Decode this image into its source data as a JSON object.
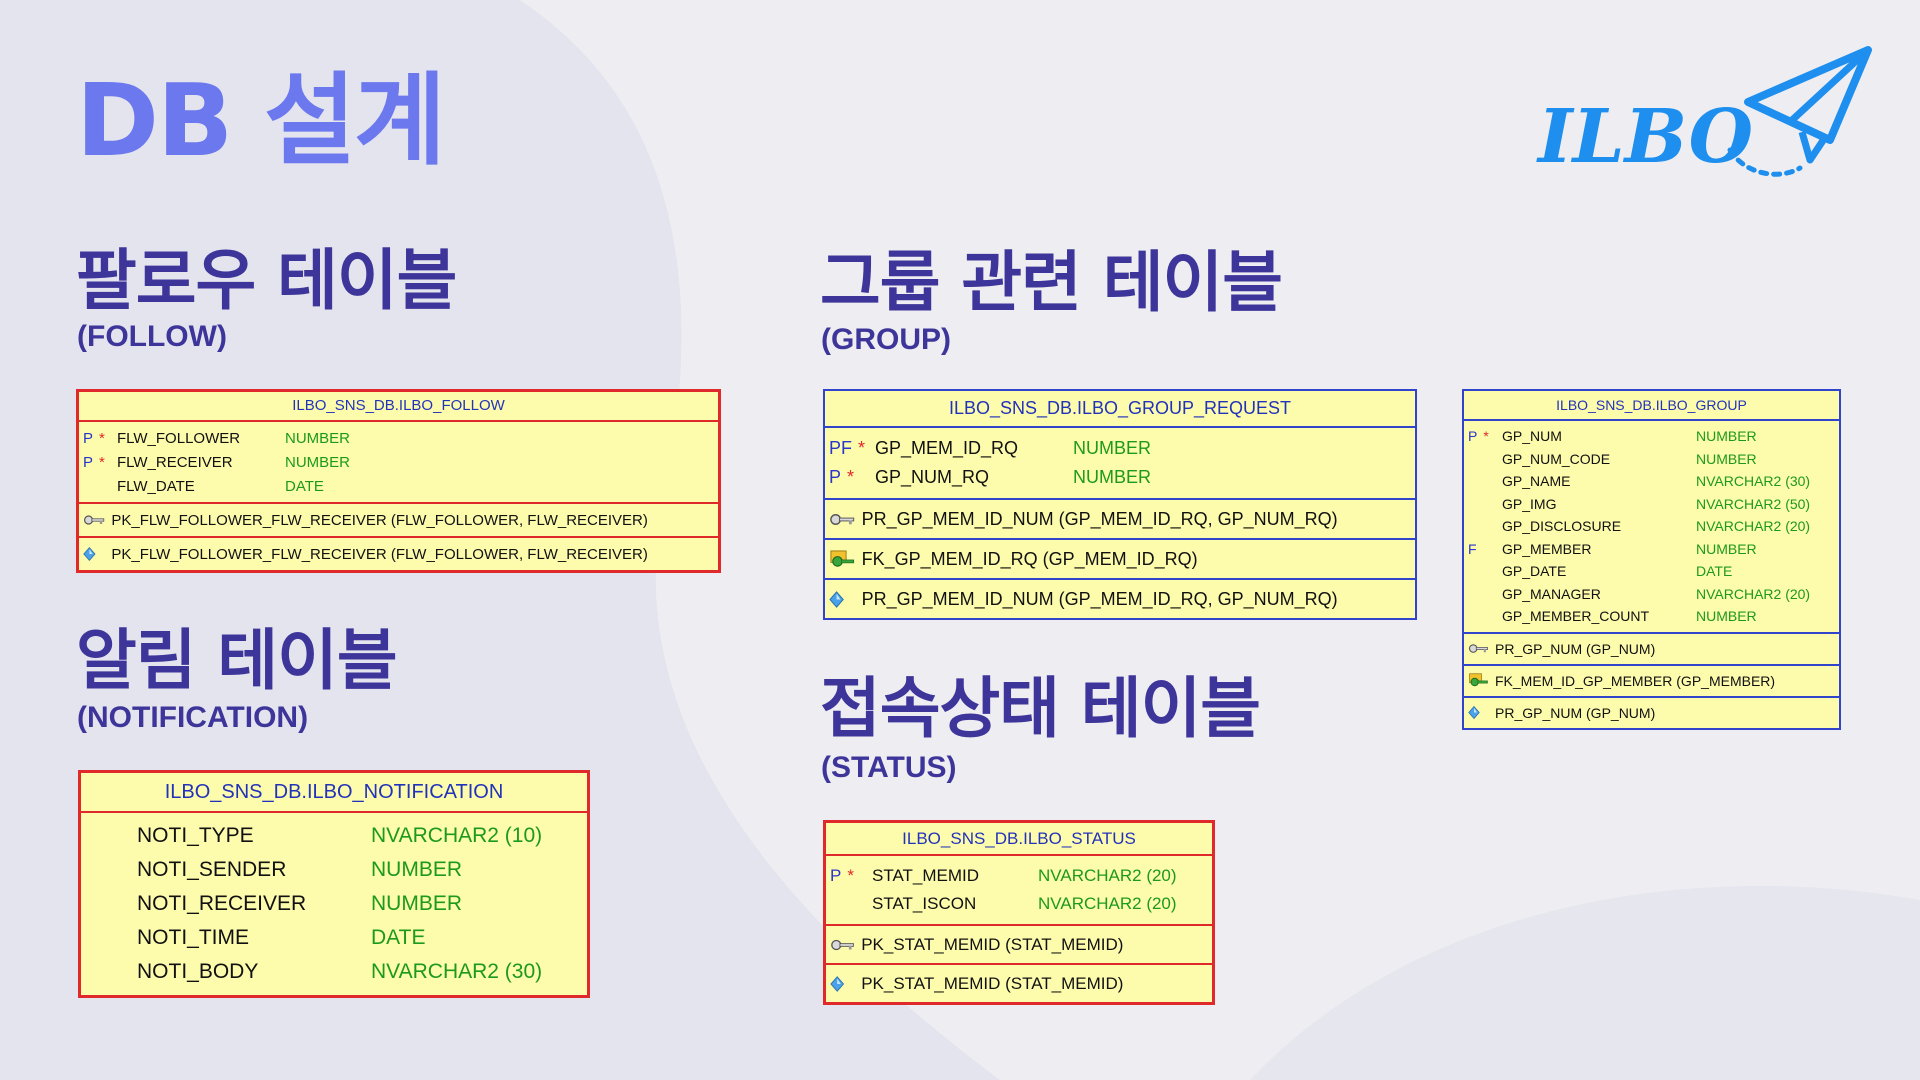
{
  "page": {
    "title": "DB 설계",
    "logo_text": "ILBO",
    "colors": {
      "title": "#6b78ee",
      "heading": "#3d359a",
      "logo": "#1e8fee",
      "erd_bg": "#fdfbac",
      "erd_red": "#e0292a",
      "erd_blue": "#3344cc",
      "type_green": "#1d9a1d"
    }
  },
  "sections": {
    "follow": {
      "title": "팔로우 테이블",
      "subtitle": "(FOLLOW)"
    },
    "notification": {
      "title": "알림 테이블",
      "subtitle": "(NOTIFICATION)"
    },
    "group": {
      "title": "그룹 관련 테이블",
      "subtitle": "(GROUP)"
    },
    "status": {
      "title": "접속상태 테이블",
      "subtitle": "(STATUS)"
    }
  },
  "tables": {
    "follow": {
      "name": "ILBO_SNS_DB.ILBO_FOLLOW",
      "columns": [
        {
          "flag": "P",
          "required": "*",
          "name": "FLW_FOLLOWER",
          "type": "NUMBER"
        },
        {
          "flag": "P",
          "required": "*",
          "name": "FLW_RECEIVER",
          "type": "NUMBER"
        },
        {
          "flag": "",
          "required": "",
          "name": "FLW_DATE",
          "type": "DATE"
        }
      ],
      "keys": [
        {
          "icon": "primary-key-icon",
          "text": "PK_FLW_FOLLOWER_FLW_RECEIVER (FLW_FOLLOWER, FLW_RECEIVER)"
        },
        {
          "icon": "index-diamond-icon",
          "text": "PK_FLW_FOLLOWER_FLW_RECEIVER (FLW_FOLLOWER, FLW_RECEIVER)"
        }
      ]
    },
    "notification": {
      "name": "ILBO_SNS_DB.ILBO_NOTIFICATION",
      "columns": [
        {
          "flag": "",
          "required": "",
          "name": "NOTI_TYPE",
          "type": "NVARCHAR2 (10)"
        },
        {
          "flag": "",
          "required": "",
          "name": "NOTI_SENDER",
          "type": "NUMBER"
        },
        {
          "flag": "",
          "required": "",
          "name": "NOTI_RECEIVER",
          "type": "NUMBER"
        },
        {
          "flag": "",
          "required": "",
          "name": "NOTI_TIME",
          "type": "DATE"
        },
        {
          "flag": "",
          "required": "",
          "name": "NOTI_BODY",
          "type": "NVARCHAR2 (30)"
        }
      ],
      "keys": []
    },
    "group_request": {
      "name": "ILBO_SNS_DB.ILBO_GROUP_REQUEST",
      "columns": [
        {
          "flag": "PF",
          "required": "*",
          "name": "GP_MEM_ID_RQ",
          "type": "NUMBER"
        },
        {
          "flag": "P",
          "required": "*",
          "name": "GP_NUM_RQ",
          "type": "NUMBER"
        }
      ],
      "keys": [
        {
          "icon": "primary-key-icon",
          "text": "PR_GP_MEM_ID_NUM (GP_MEM_ID_RQ, GP_NUM_RQ)"
        },
        {
          "icon": "foreign-key-icon",
          "text": "FK_GP_MEM_ID_RQ (GP_MEM_ID_RQ)"
        },
        {
          "icon": "index-diamond-icon",
          "text": "PR_GP_MEM_ID_NUM (GP_MEM_ID_RQ, GP_NUM_RQ)"
        }
      ]
    },
    "group": {
      "name": "ILBO_SNS_DB.ILBO_GROUP",
      "columns": [
        {
          "flag": "P",
          "required": "*",
          "name": "GP_NUM",
          "type": "NUMBER"
        },
        {
          "flag": "",
          "required": "",
          "name": "GP_NUM_CODE",
          "type": "NUMBER"
        },
        {
          "flag": "",
          "required": "",
          "name": "GP_NAME",
          "type": "NVARCHAR2 (30)"
        },
        {
          "flag": "",
          "required": "",
          "name": "GP_IMG",
          "type": "NVARCHAR2 (50)"
        },
        {
          "flag": "",
          "required": "",
          "name": "GP_DISCLOSURE",
          "type": "NVARCHAR2 (20)"
        },
        {
          "flag": "F",
          "required": "",
          "name": "GP_MEMBER",
          "type": "NUMBER"
        },
        {
          "flag": "",
          "required": "",
          "name": "GP_DATE",
          "type": "DATE"
        },
        {
          "flag": "",
          "required": "",
          "name": "GP_MANAGER",
          "type": "NVARCHAR2 (20)"
        },
        {
          "flag": "",
          "required": "",
          "name": "GP_MEMBER_COUNT",
          "type": "NUMBER"
        }
      ],
      "keys": [
        {
          "icon": "primary-key-icon",
          "text": "PR_GP_NUM (GP_NUM)"
        },
        {
          "icon": "foreign-key-icon",
          "text": "FK_MEM_ID_GP_MEMBER (GP_MEMBER)"
        },
        {
          "icon": "index-diamond-icon",
          "text": "PR_GP_NUM (GP_NUM)"
        }
      ]
    },
    "status": {
      "name": "ILBO_SNS_DB.ILBO_STATUS",
      "columns": [
        {
          "flag": "P",
          "required": "*",
          "name": "STAT_MEMID",
          "type": "NVARCHAR2 (20)"
        },
        {
          "flag": "",
          "required": "",
          "name": "STAT_ISCON",
          "type": "NVARCHAR2 (20)"
        }
      ],
      "keys": [
        {
          "icon": "primary-key-icon",
          "text": "PK_STAT_MEMID (STAT_MEMID)"
        },
        {
          "icon": "index-diamond-icon",
          "text": "PK_STAT_MEMID (STAT_MEMID)"
        }
      ]
    }
  }
}
